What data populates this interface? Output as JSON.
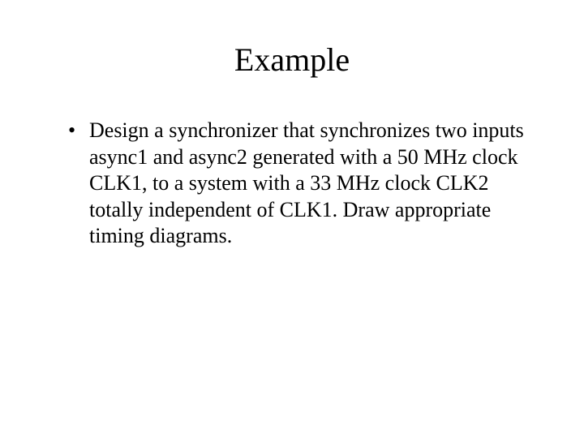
{
  "slide": {
    "title": "Example",
    "bullets": [
      "Design a synchronizer that synchronizes two inputs async1 and async2 generated with a 50 MHz clock CLK1, to a system with a 33 MHz clock CLK2 totally independent of CLK1. Draw appropriate timing diagrams."
    ]
  }
}
